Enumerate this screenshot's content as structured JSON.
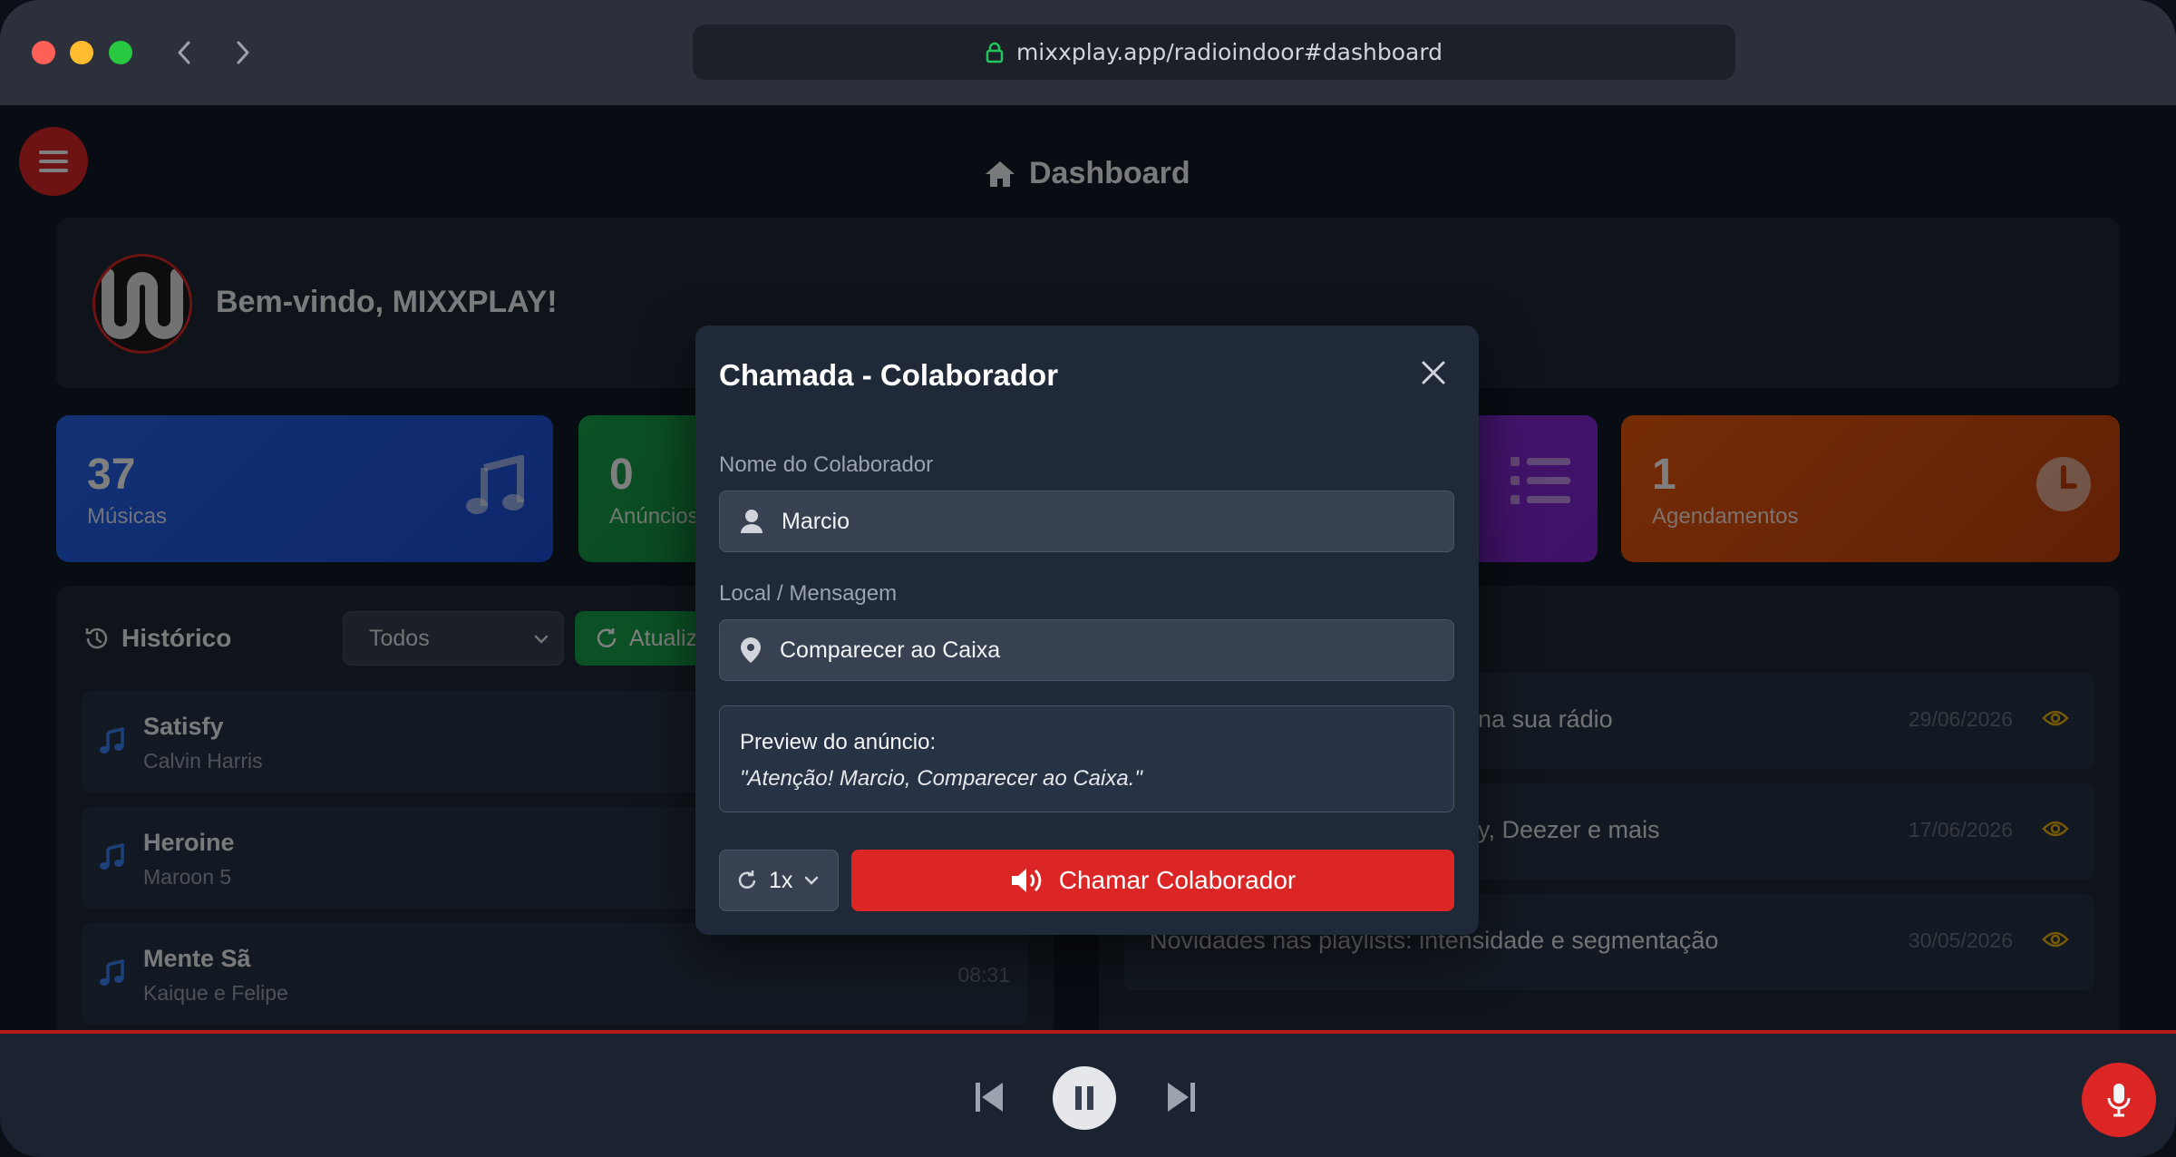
{
  "browser": {
    "url": "mixxplay.app/radioindoor#dashboard"
  },
  "page": {
    "title": "Dashboard",
    "welcome": "Bem-vindo, MIXXPLAY!"
  },
  "stats": [
    {
      "value": "37",
      "label": "Músicas",
      "icon": "music-icon"
    },
    {
      "value": "0",
      "label": "Anúncios",
      "icon": "megaphone-icon"
    },
    {
      "value": "",
      "label": "",
      "icon": "list-icon"
    },
    {
      "value": "1",
      "label": "Agendamentos",
      "icon": "clock-icon"
    }
  ],
  "history": {
    "title": "Histórico",
    "filter": "Todos",
    "refresh_label": "Atualizar",
    "items": [
      {
        "title": "Satisfy",
        "artist": "Calvin Harris",
        "time": ""
      },
      {
        "title": "Heroine",
        "artist": "Maroon 5",
        "time": ""
      },
      {
        "title": "Mente Sã",
        "artist": "Kaique e Felipe",
        "time": "08:31"
      }
    ]
  },
  "news": {
    "items": [
      {
        "title": "na sua rádio",
        "date": "29/06/2026"
      },
      {
        "title": "y, Deezer e mais",
        "date": "17/06/2026"
      },
      {
        "title": "Novidades nas playlists: intensidade e segmentação",
        "date": "30/05/2026"
      }
    ]
  },
  "modal": {
    "title": "Chamada - Colaborador",
    "name_label": "Nome do Colaborador",
    "name_value": "Marcio",
    "message_label": "Local / Mensagem",
    "message_value": "Comparecer ao Caixa",
    "preview_label": "Preview do anúncio:",
    "preview_text": "\"Atenção! Marcio, Comparecer ao Caixa.\"",
    "repeat_value": "1x",
    "call_button": "Chamar Colaborador"
  },
  "colors": {
    "accent": "#dc2626",
    "background": "#111827",
    "card": "#1f2937"
  }
}
